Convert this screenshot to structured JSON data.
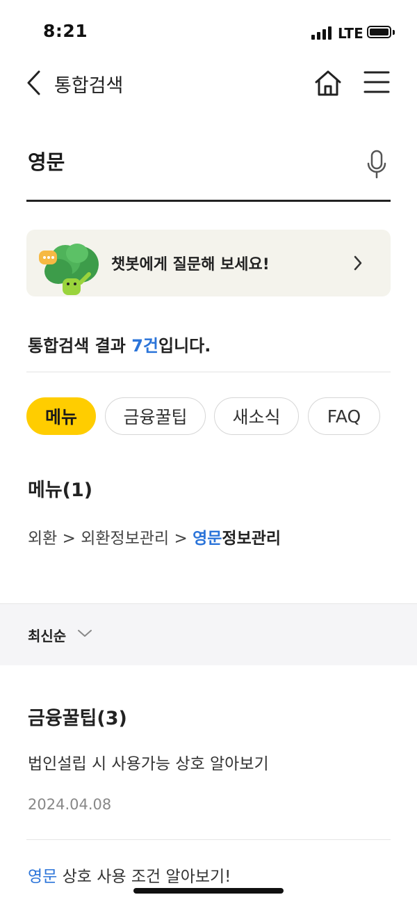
{
  "status_bar": {
    "time": "8:21",
    "network": "LTE"
  },
  "header": {
    "title": "통합검색"
  },
  "search": {
    "value": "영문"
  },
  "banner": {
    "text": "챗봇에게 질문해 보세요!"
  },
  "results": {
    "prefix": "통합검색 결과 ",
    "count": "7건",
    "suffix": "입니다."
  },
  "filters": [
    {
      "label": "메뉴",
      "active": true
    },
    {
      "label": "금융꿀팁",
      "active": false
    },
    {
      "label": "새소식",
      "active": false
    },
    {
      "label": "FAQ",
      "active": false
    }
  ],
  "menu_section": {
    "title": "메뉴(1)",
    "path_prefix": "외환 > 외환정보관리 > ",
    "path_highlight": "영문",
    "path_suffix": "정보관리"
  },
  "sort": {
    "label": "최신순"
  },
  "tips_section": {
    "title": "금융꿀팁(3)",
    "items": [
      {
        "title": "법인설립 시 사용가능 상호 알아보기",
        "date": "2024.04.08"
      },
      {
        "highlight": "영문",
        "title_rest": " 상호 사용 조건 알아보기!"
      }
    ]
  },
  "colors": {
    "accent_yellow": "#ffcd00",
    "link_blue": "#2b74d9",
    "banner_bg": "#f4f3ec"
  }
}
